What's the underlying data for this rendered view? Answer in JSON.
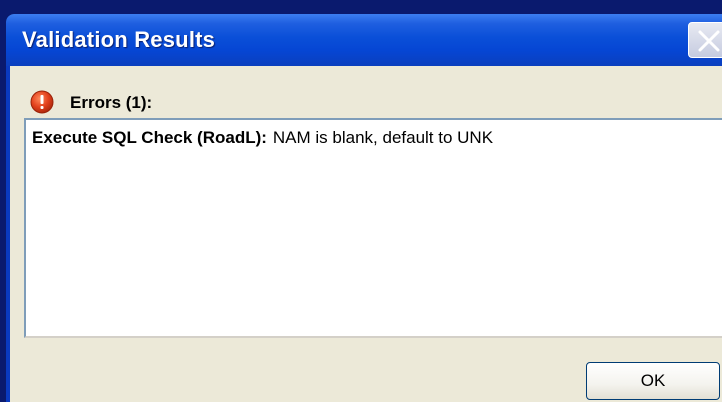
{
  "window": {
    "title": "Validation Results"
  },
  "errors": {
    "label": "Errors (1):",
    "icon": "error-icon"
  },
  "results": [
    {
      "source": "Execute SQL Check (RoadL):",
      "message": "NAM is blank, default to UNK"
    }
  ],
  "buttons": {
    "ok_label": "OK"
  },
  "colors": {
    "titlebar": "#0646d4",
    "client_bg": "#ece9d8",
    "error_icon": "#d83a1a"
  }
}
